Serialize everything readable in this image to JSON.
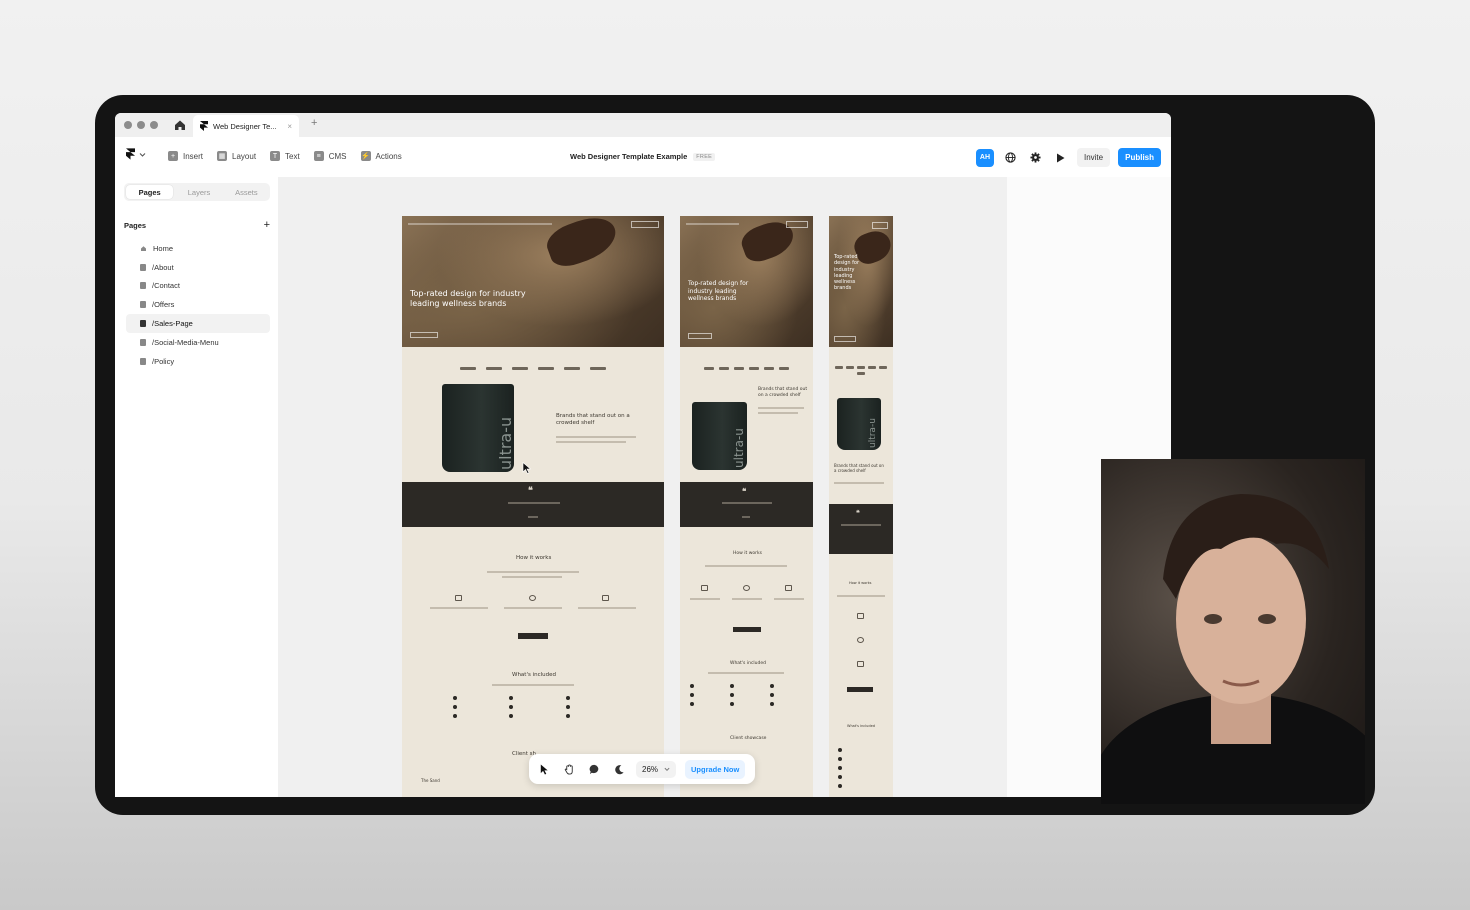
{
  "browser": {
    "tab_title": "Web Designer Te...",
    "tab_close": "×",
    "new_tab": "+"
  },
  "toolbar": {
    "menu": [
      {
        "label": "Insert",
        "icon": "+"
      },
      {
        "label": "Layout",
        "icon": "▦"
      },
      {
        "label": "Text",
        "icon": "T"
      },
      {
        "label": "CMS",
        "icon": "≡"
      },
      {
        "label": "Actions",
        "icon": "⚡"
      }
    ],
    "project_title": "Web Designer Template Example",
    "plan_badge": "FREE",
    "avatar": "AH",
    "invite_label": "Invite",
    "publish_label": "Publish",
    "accent_color": "#1a8fff"
  },
  "left_panel": {
    "tabs": [
      "Pages",
      "Layers",
      "Assets"
    ],
    "active_tab": "Pages",
    "section_title": "Pages",
    "add_label": "+",
    "pages": [
      {
        "label": "Home",
        "icon": "home-icon"
      },
      {
        "label": "/About",
        "icon": "page-icon"
      },
      {
        "label": "/Contact",
        "icon": "page-icon"
      },
      {
        "label": "/Offers",
        "icon": "page-icon"
      },
      {
        "label": "/Sales-Page",
        "icon": "page-icon",
        "selected": true
      },
      {
        "label": "/Social-Media-Menu",
        "icon": "page-icon"
      },
      {
        "label": "/Policy",
        "icon": "page-icon"
      }
    ]
  },
  "preview": {
    "desktop": {
      "hero_heading": "Top-rated design for industry leading wellness brands",
      "product_heading": "Brands that stand out on a crowded shelf",
      "product_brand": "ultra-u",
      "quote_mark": "❝",
      "how_title": "How it works",
      "included_title": "What's included",
      "client_title": "Client sh",
      "footer_logo": "The Sand"
    },
    "tablet": {
      "hero_heading": "Top-rated design for industry leading wellness brands",
      "product_heading": "Brands that stand out on a crowded shelf",
      "product_brand": "ultra-u",
      "quote_mark": "❝",
      "how_title": "How it works",
      "included_title": "What's included",
      "client_title": "Client showcase"
    },
    "mobile": {
      "hero_heading": "Top-rated design for industry leading wellness brands",
      "product_heading": "Brands that stand out on a crowded shelf",
      "product_brand": "ultra-u",
      "quote_mark": "❝",
      "how_title": "How it works",
      "included_title": "What's included"
    }
  },
  "bottom_toolbar": {
    "zoom": "26%",
    "upgrade_label": "Upgrade Now"
  }
}
